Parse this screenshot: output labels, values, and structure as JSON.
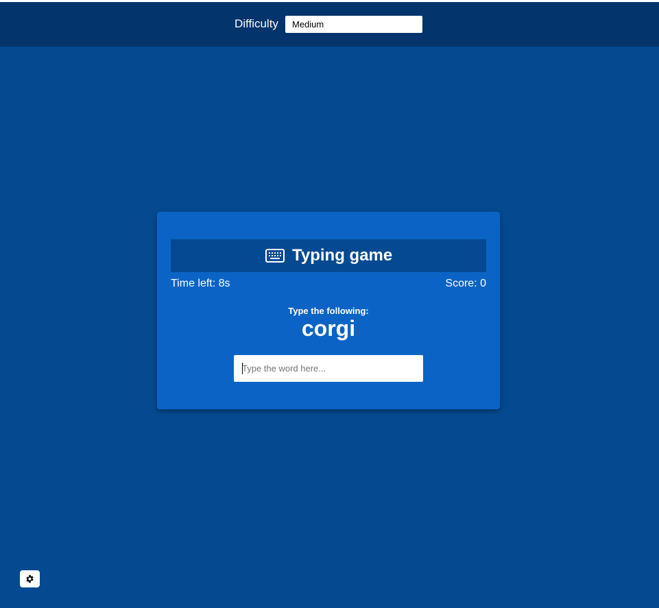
{
  "settings": {
    "difficulty_label": "Difficulty",
    "difficulty_selected": "Medium",
    "button_icon": "gear-icon"
  },
  "game": {
    "title": "Typing game",
    "title_icon": "keyboard-icon",
    "time_left_text": "Time left: 8s",
    "score_text": "Score: 0",
    "prompt_label": "Type the following:",
    "current_word": "corgi",
    "input_placeholder": "Type the word here...",
    "input_value": ""
  },
  "colors": {
    "background": "#054a91",
    "settings_bar": "#03346b",
    "card": "#0b64c5",
    "title_bar": "#044a92",
    "text": "#ffffff"
  }
}
